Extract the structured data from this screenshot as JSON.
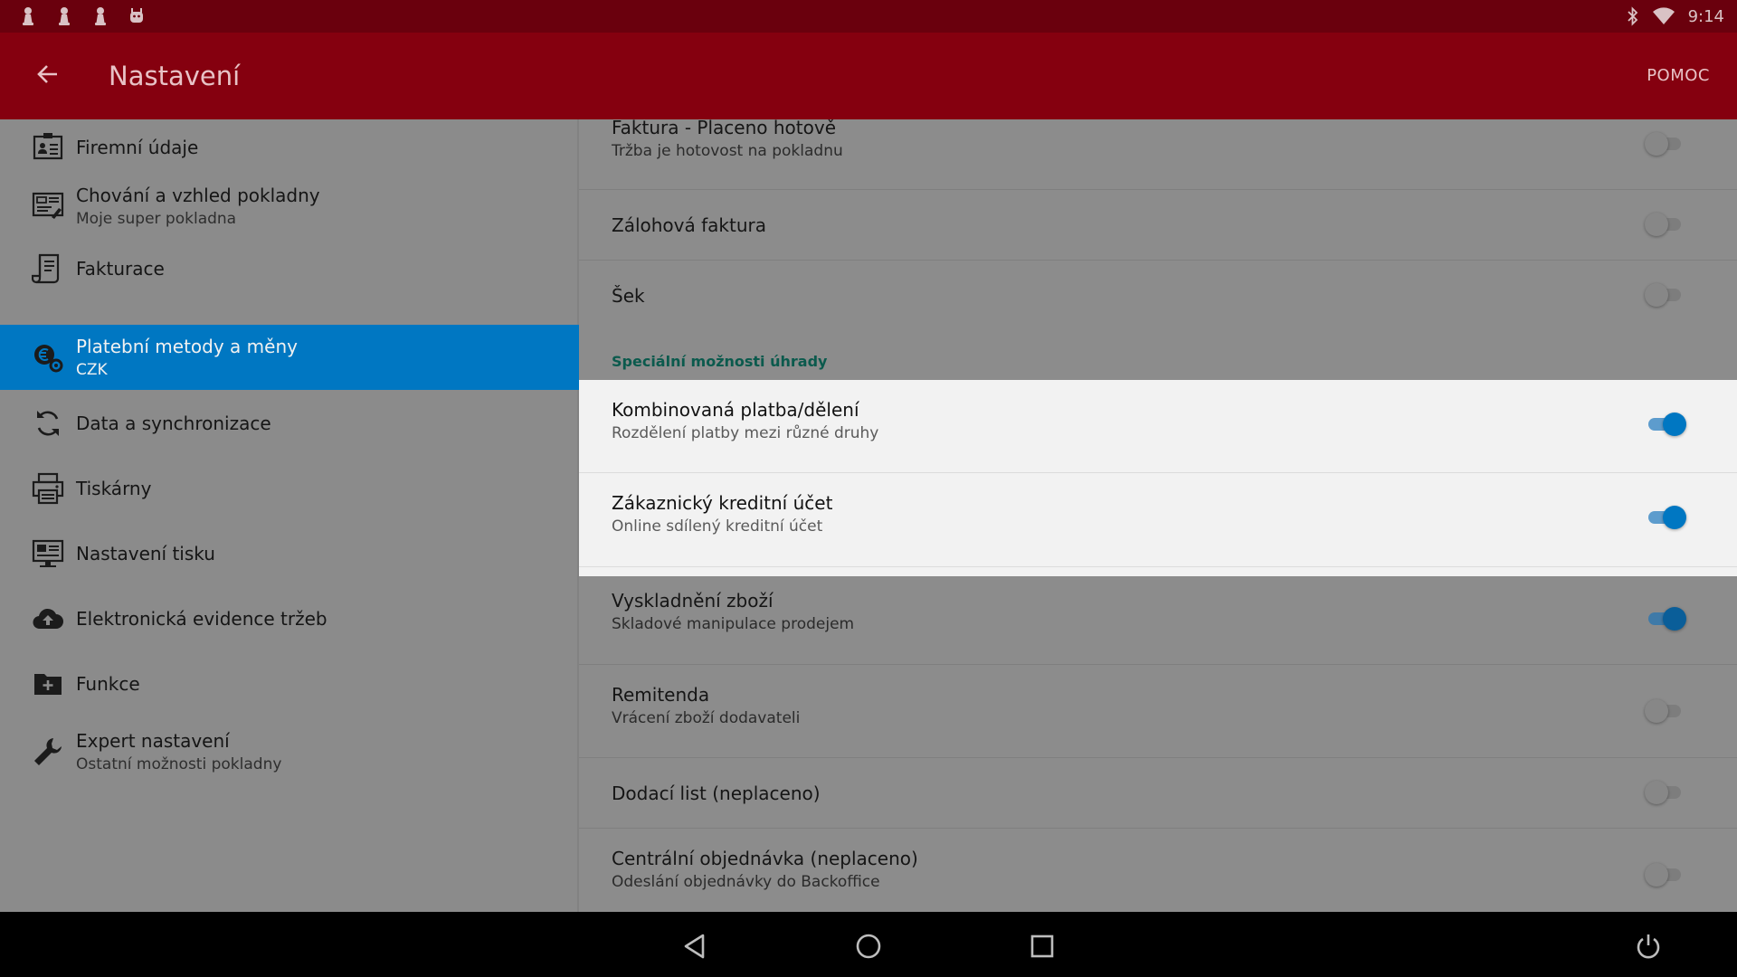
{
  "status_bar": {
    "time": "9:14"
  },
  "app_bar": {
    "title": "Nastavení",
    "help_label": "POMOC"
  },
  "sidebar": {
    "items": [
      {
        "label": "Firemní údaje",
        "subtitle": "",
        "icon": "company-card-icon"
      },
      {
        "label": "Chování a vzhled pokladny",
        "subtitle": "Moje super pokladna",
        "icon": "register-appearance-icon"
      },
      {
        "label": "Fakturace",
        "subtitle": "",
        "icon": "invoice-icon"
      },
      {
        "label": "Platební metody a měny",
        "subtitle": "CZK",
        "icon": "currency-gear-icon",
        "selected": true
      },
      {
        "label": "Data a synchronizace",
        "subtitle": "",
        "icon": "sync-icon"
      },
      {
        "label": "Tiskárny",
        "subtitle": "",
        "icon": "printer-icon"
      },
      {
        "label": "Nastavení tisku",
        "subtitle": "",
        "icon": "print-settings-icon"
      },
      {
        "label": "Elektronická evidence tržeb",
        "subtitle": "",
        "icon": "cloud-upload-icon"
      },
      {
        "label": "Funkce",
        "subtitle": "",
        "icon": "folder-plus-icon"
      },
      {
        "label": "Expert nastavení",
        "subtitle": "Ostatní možnosti pokladny",
        "icon": "wrench-icon"
      }
    ]
  },
  "settings": {
    "rows_top": [
      {
        "title": "Faktura - Placeno hotově",
        "subtitle": "Tržba je hotovost na pokladnu",
        "enabled": false
      },
      {
        "title": "Zálohová faktura",
        "subtitle": "",
        "enabled": false
      },
      {
        "title": "Šek",
        "subtitle": "",
        "enabled": false
      }
    ],
    "section_header": "Speciální možnosti úhrady",
    "rows_special": [
      {
        "title": "Kombinovaná platba/dělení",
        "subtitle": "Rozdělení platby mezi různé druhy",
        "enabled": true
      },
      {
        "title": "Zákaznický kreditní účet",
        "subtitle": "Online sdílený kreditní účet",
        "enabled": true
      }
    ],
    "rows_bottom": [
      {
        "title": "Vyskladnění zboží",
        "subtitle": "Skladové manipulace prodejem",
        "enabled": true
      },
      {
        "title": "Remitenda",
        "subtitle": "Vrácení zboží dodavateli",
        "enabled": false
      },
      {
        "title": "Dodací list (neplaceno)",
        "subtitle": "",
        "enabled": false
      },
      {
        "title": "Centrální objednávka (neplaceno)",
        "subtitle": "Odeslání objednávky do Backoffice",
        "enabled": false
      }
    ]
  },
  "colors": {
    "status_bar": "#6a000d",
    "app_bar": "#85000f",
    "selected_item": "#0077c2",
    "switch_on": "#0077c2",
    "section_header": "#0b5a4d"
  }
}
